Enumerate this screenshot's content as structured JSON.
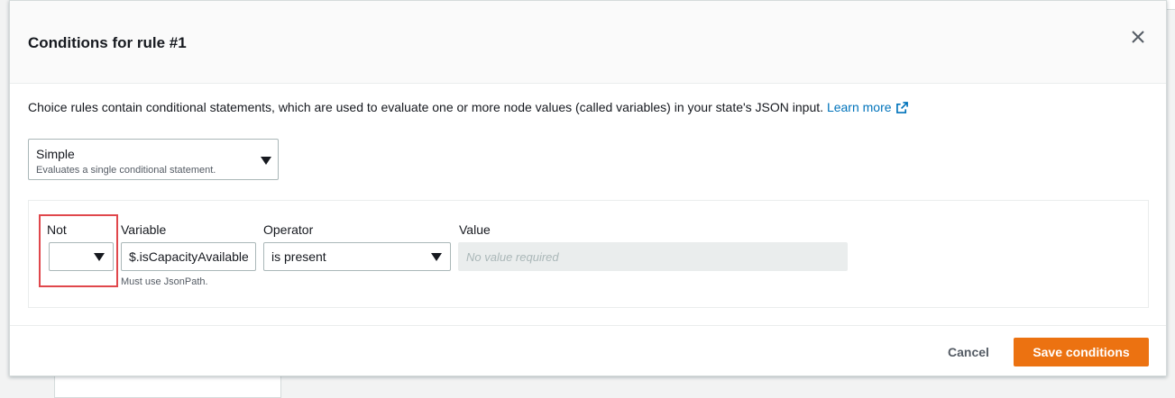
{
  "modal": {
    "title": "Conditions for rule #1",
    "description": "Choice rules contain conditional statements, which are used to evaluate one or more node values (called variables) in your state's JSON input.",
    "learn_more": "Learn more"
  },
  "mode_select": {
    "value": "Simple",
    "subtext": "Evaluates a single conditional statement."
  },
  "condition": {
    "not_label": "Not",
    "not_value": "",
    "variable_label": "Variable",
    "variable_value": "$.isCapacityAvailable",
    "variable_help": "Must use JsonPath.",
    "operator_label": "Operator",
    "operator_value": "is present",
    "value_label": "Value",
    "value_placeholder": "No value required"
  },
  "footer": {
    "cancel_label": "Cancel",
    "save_label": "Save conditions"
  },
  "colors": {
    "primary": "#ec7211",
    "link": "#0073bb",
    "highlight": "#e0474c"
  },
  "icons": {
    "close": "close-icon",
    "external": "external-link-icon",
    "caret": "caret-down-icon"
  }
}
